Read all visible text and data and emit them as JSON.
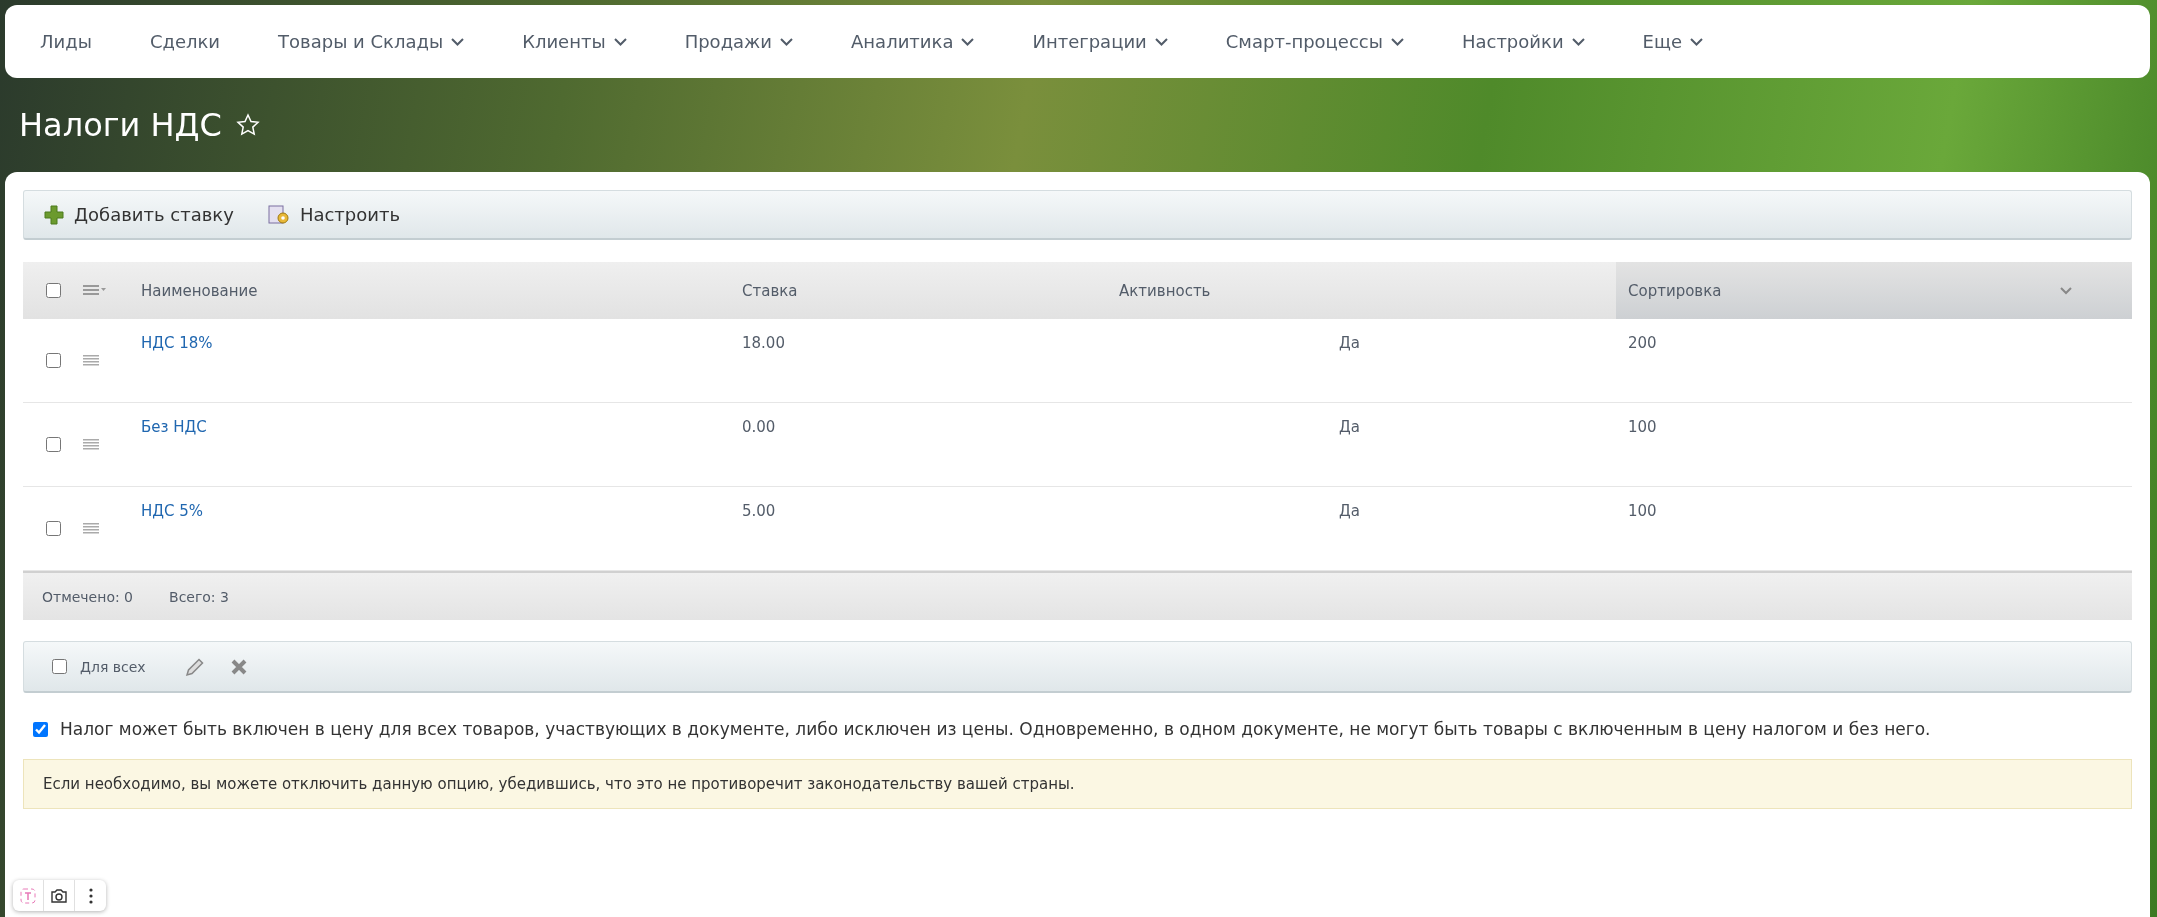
{
  "nav": [
    {
      "label": "Лиды",
      "dropdown": false
    },
    {
      "label": "Сделки",
      "dropdown": false
    },
    {
      "label": "Товары и Склады",
      "dropdown": true
    },
    {
      "label": "Клиенты",
      "dropdown": true
    },
    {
      "label": "Продажи",
      "dropdown": true
    },
    {
      "label": "Аналитика",
      "dropdown": true
    },
    {
      "label": "Интеграции",
      "dropdown": true
    },
    {
      "label": "Смарт-процессы",
      "dropdown": true
    },
    {
      "label": "Настройки",
      "dropdown": true
    },
    {
      "label": "Еще",
      "dropdown": true
    }
  ],
  "page_title": "Налоги НДС",
  "toolbar": [
    {
      "kind": "add",
      "label": "Добавить ставку"
    },
    {
      "kind": "settings",
      "label": "Настроить"
    }
  ],
  "table": {
    "select_all_checked": false,
    "columns": [
      {
        "label": "Наименование",
        "sorted": false
      },
      {
        "label": "Ставка",
        "sorted": false
      },
      {
        "label": "Активность",
        "sorted": false
      },
      {
        "label": "Сортировка",
        "sorted": true
      }
    ],
    "rows": [
      {
        "checked": false,
        "name": "НДС 18%",
        "rate": "18.00",
        "active": "Да",
        "sort": "200"
      },
      {
        "checked": false,
        "name": "Без НДС",
        "rate": "0.00",
        "active": "Да",
        "sort": "100"
      },
      {
        "checked": false,
        "name": "НДС 5%",
        "rate": "5.00",
        "active": "Да",
        "sort": "100"
      }
    ],
    "footer": [
      "Отмечено: 0",
      "Всего: 3"
    ]
  },
  "actions": {
    "for_all_label": "Для всех",
    "for_all_checked": false
  },
  "option": {
    "checked": true,
    "label": "Налог может быть включен в цену для всех товаров, участвующих в документе, либо исключен из цены. Одновременно, в одном документе, не могут быть товары с включенным в цену налогом и без него."
  },
  "note": "Если необходимо, вы можете отключить данную опцию, убедившись, что это не противоречит законодательству вашей страны."
}
